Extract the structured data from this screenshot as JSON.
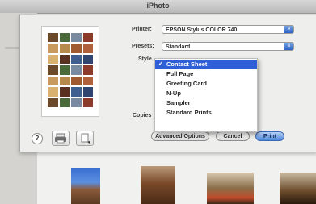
{
  "window": {
    "title": "iPhoto"
  },
  "print_sheet": {
    "printer_label": "Printer:",
    "printer_value": "EPSON Stylus COLOR 740",
    "presets_label": "Presets:",
    "presets_value": "Standard",
    "style_label": "Style",
    "style_options": [
      "Contact Sheet",
      "Full Page",
      "Greeting Card",
      "N-Up",
      "Sampler",
      "Standard Prints"
    ],
    "style_selected": "Contact Sheet",
    "copies_label": "Copies",
    "help_label": "?",
    "buttons": {
      "advanced": "Advanced Options",
      "cancel": "Cancel",
      "print": "Print"
    }
  },
  "icons": [
    "help-icon",
    "printer-icon",
    "preview-icon",
    "chevron-up-down-icon",
    "checkmark-icon"
  ],
  "colors": {
    "menu_highlight": "#2f5fd6",
    "print_button": "#4f86d8",
    "sheet_bg": "#eeeeec"
  }
}
